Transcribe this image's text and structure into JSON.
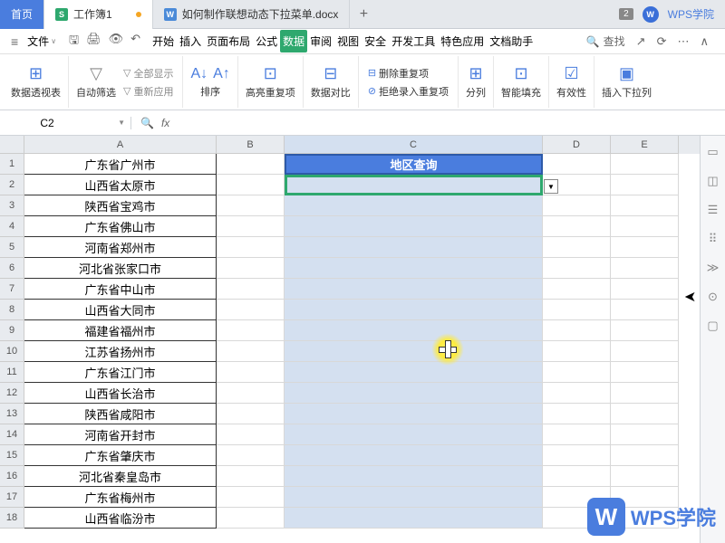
{
  "tabs": {
    "home": "首页",
    "workbook": "工作簿1",
    "doc": "如何制作联想动态下拉菜单.docx",
    "badge": "2",
    "wps_label": "WPS学院"
  },
  "menu": {
    "file": "文件",
    "items": [
      "开始",
      "插入",
      "页面布局",
      "公式",
      "数据",
      "审阅",
      "视图",
      "安全",
      "开发工具",
      "特色应用",
      "文档助手"
    ],
    "search": "查找"
  },
  "ribbon": {
    "pivot": "数据透视表",
    "autofilter": "自动筛选",
    "show_all": "全部显示",
    "reapply": "重新应用",
    "sort": "排序",
    "highlight_dup": "高亮重复项",
    "data_compare": "数据对比",
    "del_dup": "删除重复项",
    "reject_dup": "拒绝录入重复项",
    "text_to_col": "分列",
    "smart_fill": "智能填充",
    "validation": "有效性",
    "insert_dropdown": "插入下拉列"
  },
  "formula_bar": {
    "name_box": "C2",
    "fx": "fx"
  },
  "sheet": {
    "cols": [
      "A",
      "B",
      "C",
      "D",
      "E"
    ],
    "c1_header": "地区查询",
    "rows": [
      "广东省广州市",
      "山西省太原市",
      "陕西省宝鸡市",
      "广东省佛山市",
      "河南省郑州市",
      "河北省张家口市",
      "广东省中山市",
      "山西省大同市",
      "福建省福州市",
      "江苏省扬州市",
      "广东省江门市",
      "山西省长治市",
      "陕西省咸阳市",
      "河南省开封市",
      "广东省肇庆市",
      "河北省秦皇岛市",
      "广东省梅州市",
      "山西省临汾市"
    ]
  },
  "watermark": "WPS学院"
}
